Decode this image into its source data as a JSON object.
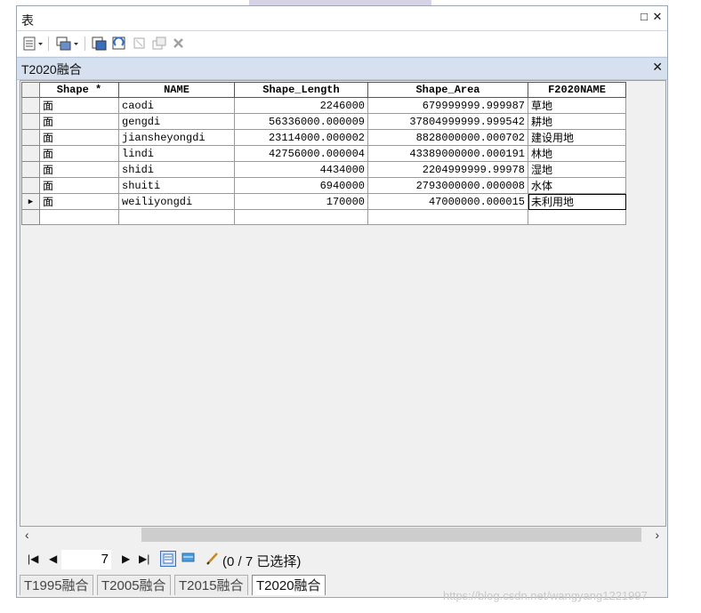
{
  "window": {
    "title": "表"
  },
  "tab": {
    "title": "T2020融合"
  },
  "table": {
    "columns": [
      "Shape *",
      "NAME",
      "Shape_Length",
      "Shape_Area",
      "F2020NAME"
    ],
    "rows": [
      {
        "shape": "面",
        "name": "caodi",
        "length": "2246000",
        "area": "679999999.999987",
        "f2020": "草地"
      },
      {
        "shape": "面",
        "name": "gengdi",
        "length": "56336000.000009",
        "area": "37804999999.999542",
        "f2020": "耕地"
      },
      {
        "shape": "面",
        "name": "jiansheyongdi",
        "length": "23114000.000002",
        "area": "8828000000.000702",
        "f2020": "建设用地"
      },
      {
        "shape": "面",
        "name": "lindi",
        "length": "42756000.000004",
        "area": "43389000000.000191",
        "f2020": "林地"
      },
      {
        "shape": "面",
        "name": "shidi",
        "length": "4434000",
        "area": "2204999999.99978",
        "f2020": "湿地"
      },
      {
        "shape": "面",
        "name": "shuiti",
        "length": "6940000",
        "area": "2793000000.000008",
        "f2020": "水体"
      },
      {
        "shape": "面",
        "name": "weiliyongdi",
        "length": "170000",
        "area": "47000000.000015",
        "f2020": "未利用地"
      }
    ]
  },
  "navigation": {
    "record": "7",
    "selection_text": "(0 / 7 已选择)"
  },
  "bottom_tabs": [
    "T1995融合",
    "T2005融合",
    "T2015融合",
    "T2020融合"
  ],
  "watermark": "https://blog.csdn.net/wangyang1221997"
}
